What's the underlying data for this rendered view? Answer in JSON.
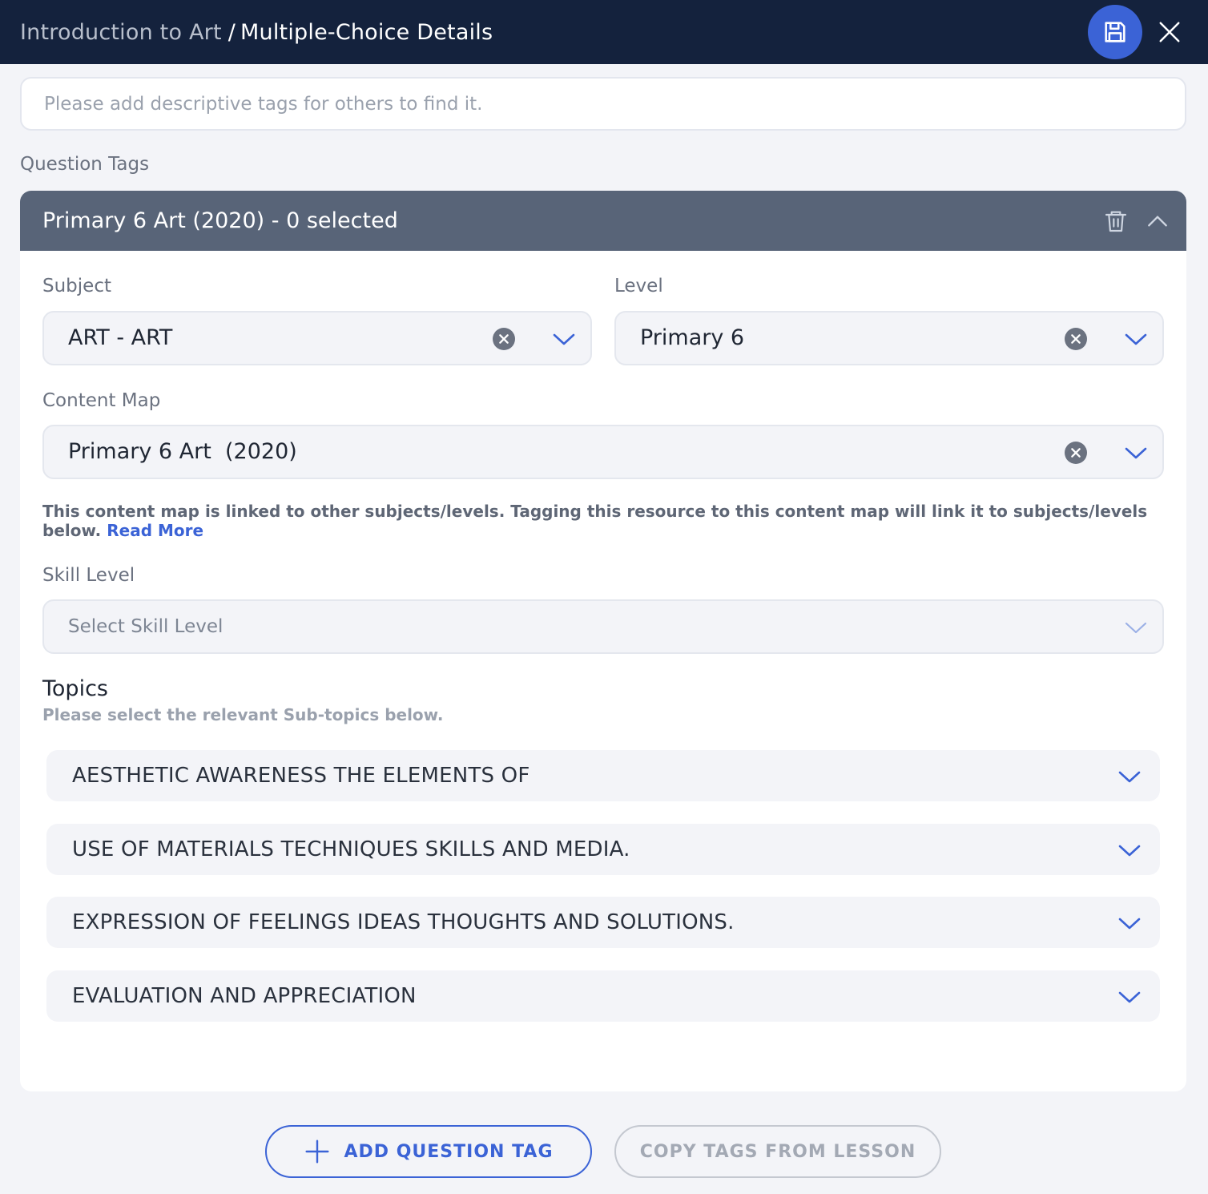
{
  "header": {
    "breadcrumb_parent": "Introduction to Art",
    "breadcrumb_separator": "/",
    "title": "Multiple-Choice Details",
    "save_icon": "floppy-disk-icon",
    "close_icon": "close-icon",
    "background": "#14223d",
    "accent": "#3b63d6"
  },
  "tags_input": {
    "placeholder": "Please add descriptive tags for others to find it.",
    "value": ""
  },
  "question_tags": {
    "section_label": "Question Tags",
    "card_title": "Primary 6 Art (2020) - 0 selected",
    "header_color": "#586478",
    "fields": {
      "subject": {
        "label": "Subject",
        "value": "ART - ART"
      },
      "level": {
        "label": "Level",
        "value": "Primary 6"
      },
      "content_map": {
        "label": "Content Map",
        "value": "Primary 6 Art  (2020)"
      }
    },
    "note": {
      "text": "This content map is linked to other subjects/levels. Tagging this resource to this content map will link it to subjects/levels below.",
      "link": "Read More"
    },
    "skill_level": {
      "label": "Skill Level",
      "placeholder": "Select Skill Level"
    },
    "topics": {
      "title": "Topics",
      "subtitle": "Please select the relevant Sub-topics below.",
      "items": [
        "AESTHETIC AWARENESS THE ELEMENTS OF",
        "USE OF MATERIALS TECHNIQUES SKILLS AND MEDIA.",
        "EXPRESSION OF FEELINGS IDEAS THOUGHTS AND SOLUTIONS.",
        "EVALUATION AND APPRECIATION"
      ]
    }
  },
  "footer": {
    "add_button": "ADD QUESTION TAG",
    "copy_button": "COPY TAGS FROM LESSON"
  }
}
